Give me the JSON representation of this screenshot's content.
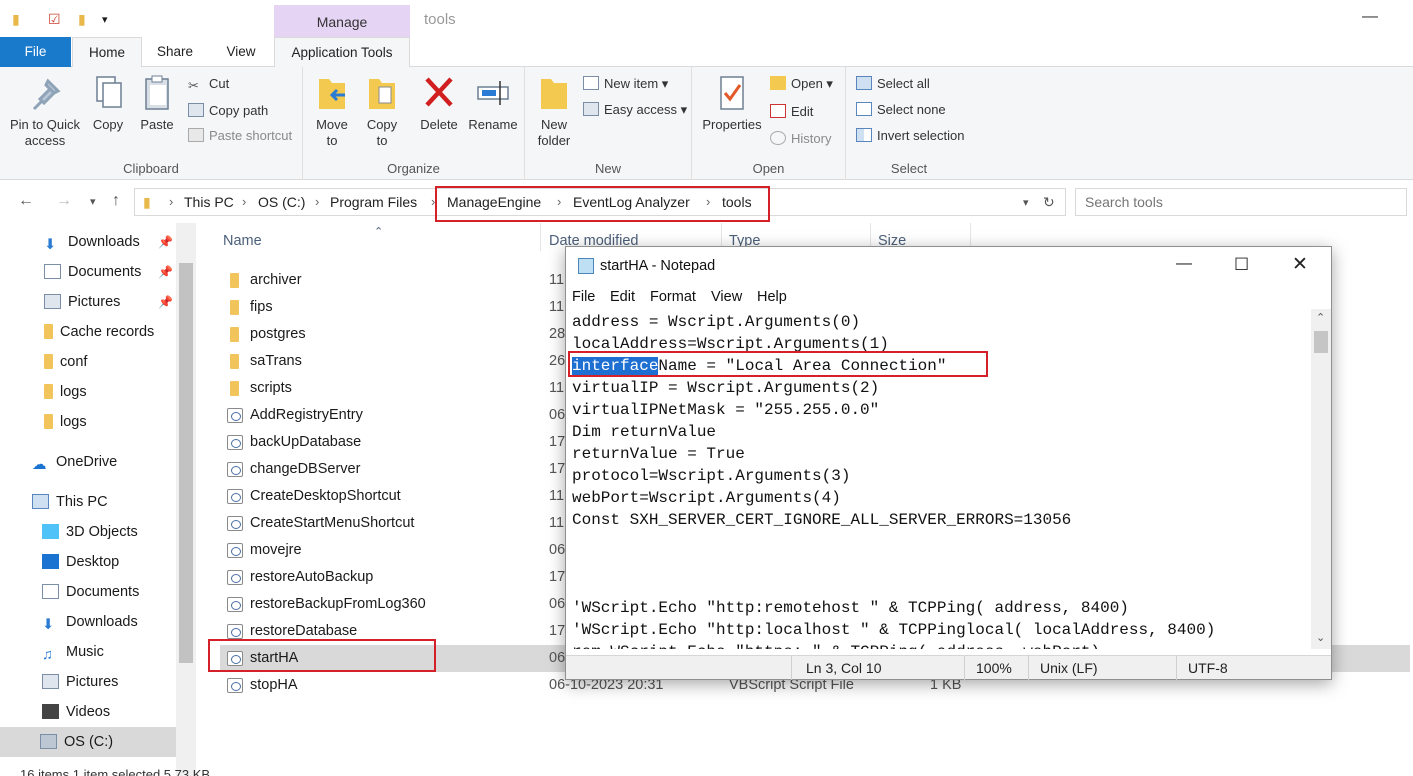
{
  "titlebar": {
    "manage_label": "Manage",
    "window_title": "tools"
  },
  "tabs": {
    "file": "File",
    "home": "Home",
    "share": "Share",
    "view": "View",
    "application_tools": "Application Tools"
  },
  "ribbon": {
    "clipboard": {
      "label": "Clipboard",
      "pin": "Pin to Quick access",
      "copy": "Copy",
      "paste": "Paste",
      "cut": "Cut",
      "copy_path": "Copy path",
      "paste_shortcut": "Paste shortcut"
    },
    "organize": {
      "label": "Organize",
      "move_to": "Move to",
      "copy_to": "Copy to",
      "delete": "Delete",
      "rename": "Rename"
    },
    "new": {
      "label": "New",
      "new_folder": "New folder",
      "new_item": "New item",
      "easy_access": "Easy access"
    },
    "open": {
      "label": "Open",
      "properties": "Properties",
      "open": "Open",
      "edit": "Edit",
      "history": "History"
    },
    "select": {
      "label": "Select",
      "select_all": "Select all",
      "select_none": "Select none",
      "invert_selection": "Invert selection"
    }
  },
  "address": {
    "crumbs": [
      "This PC",
      "OS (C:)",
      "Program Files",
      "ManageEngine",
      "EventLog Analyzer",
      "tools"
    ],
    "search_placeholder": "Search tools"
  },
  "navpane": {
    "items": [
      "Downloads",
      "Documents",
      "Pictures",
      "Cache records",
      "conf",
      "logs",
      "logs",
      "OneDrive",
      "This PC",
      "3D Objects",
      "Desktop",
      "Documents",
      "Downloads",
      "Music",
      "Pictures",
      "Videos",
      "OS (C:)"
    ]
  },
  "filelist": {
    "columns": {
      "name": "Name",
      "date": "Date modified",
      "type": "Type",
      "size": "Size"
    },
    "rows": [
      {
        "name": "archiver",
        "date": "11",
        "type": "",
        "size": ""
      },
      {
        "name": "fips",
        "date": "11",
        "type": "",
        "size": ""
      },
      {
        "name": "postgres",
        "date": "28",
        "type": "",
        "size": ""
      },
      {
        "name": "saTrans",
        "date": "26",
        "type": "",
        "size": ""
      },
      {
        "name": "scripts",
        "date": "11",
        "type": "",
        "size": ""
      },
      {
        "name": "AddRegistryEntry",
        "date": "06",
        "type": "",
        "size": ""
      },
      {
        "name": "backUpDatabase",
        "date": "17",
        "type": "",
        "size": ""
      },
      {
        "name": "changeDBServer",
        "date": "17",
        "type": "",
        "size": ""
      },
      {
        "name": "CreateDesktopShortcut",
        "date": "11",
        "type": "",
        "size": ""
      },
      {
        "name": "CreateStartMenuShortcut",
        "date": "11",
        "type": "",
        "size": ""
      },
      {
        "name": "movejre",
        "date": "06",
        "type": "",
        "size": ""
      },
      {
        "name": "restoreAutoBackup",
        "date": "17",
        "type": "",
        "size": ""
      },
      {
        "name": "restoreBackupFromLog360",
        "date": "06",
        "type": "",
        "size": ""
      },
      {
        "name": "restoreDatabase",
        "date": "17",
        "type": "",
        "size": ""
      },
      {
        "name": "startHA",
        "date": "06",
        "type": "",
        "size": ""
      },
      {
        "name": "stopHA",
        "date": "06-10-2023 20:31",
        "type": "VBScript Script File",
        "size": "1 KB"
      }
    ],
    "status": "16 items    1 item selected  5.73 KB"
  },
  "notepad": {
    "title": "startHA - Notepad",
    "menu": [
      "File",
      "Edit",
      "Format",
      "View",
      "Help"
    ],
    "line1": "address = Wscript.Arguments(0)",
    "line2": "localAddress=Wscript.Arguments(1)",
    "line3_selected": "interface",
    "line3_rest": "Name = \"Local Area Connection\"",
    "line4": "virtualIP = Wscript.Arguments(2)",
    "line5": "virtualIPNetMask = \"255.255.0.0\"",
    "line6": "Dim returnValue",
    "line7": "returnValue = True",
    "line8": "protocol=Wscript.Arguments(3)",
    "line9": "webPort=Wscript.Arguments(4)",
    "line10": "Const SXH_SERVER_CERT_IGNORE_ALL_SERVER_ERRORS=13056",
    "line14": "'WScript.Echo \"http:remotehost \" & TCPPing( address, 8400)",
    "line15": "'WScript.Echo \"http:localhost \" & TCPPinglocal( localAddress, 8400)",
    "line16": "rem WScript.Echo \"https: \" & TCPPing( address, webPort)",
    "status": {
      "position": "Ln 3, Col 10",
      "zoom": "100%",
      "line_ending": "Unix (LF)",
      "encoding": "UTF-8"
    }
  },
  "colors": {
    "accent": "#1979ca",
    "highlight_box": "#d32029",
    "manage_tab": "#e6d4f5",
    "selection": "#1d6fd1"
  }
}
